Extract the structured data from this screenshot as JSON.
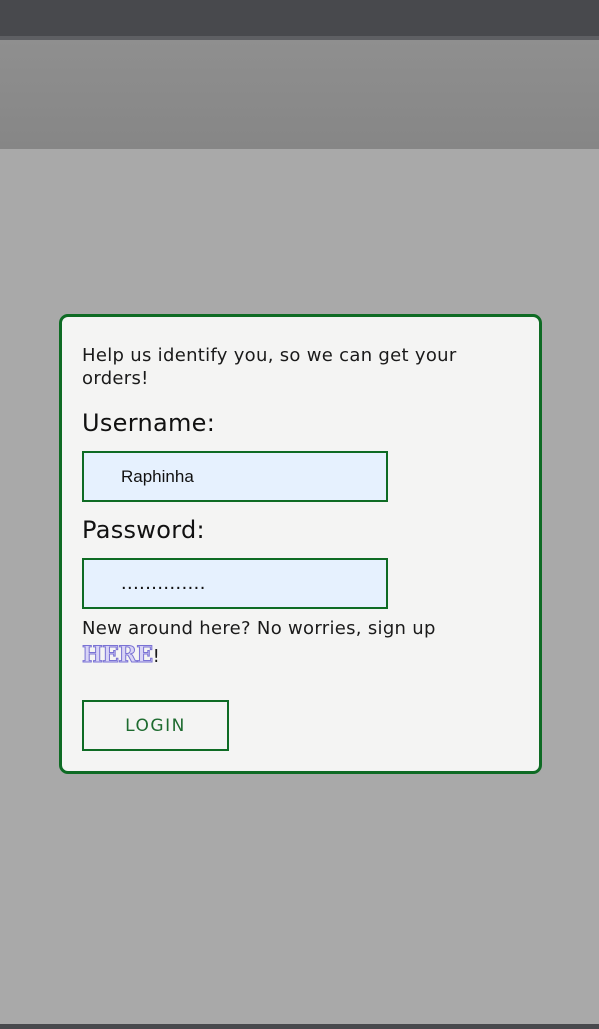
{
  "login_card": {
    "intro_text": "Help us identify you, so we can get your orders!",
    "username_label": "Username:",
    "username_value": "Raphinha",
    "password_label": "Password:",
    "password_value": "..............",
    "signup_prefix": "New around here? No worries, sign up ",
    "signup_link": "HERE",
    "signup_suffix": "!",
    "login_button": "LOGIN"
  },
  "colors": {
    "accent_border": "#0e6b24",
    "card_background": "#f4f4f3",
    "input_background": "#e6f1fe",
    "page_background": "#a9a9a9",
    "header_band": "#8a8a8a",
    "top_strip": "#48494d",
    "link_fill": "#d8d4f6",
    "link_outline": "#7a72d4"
  }
}
